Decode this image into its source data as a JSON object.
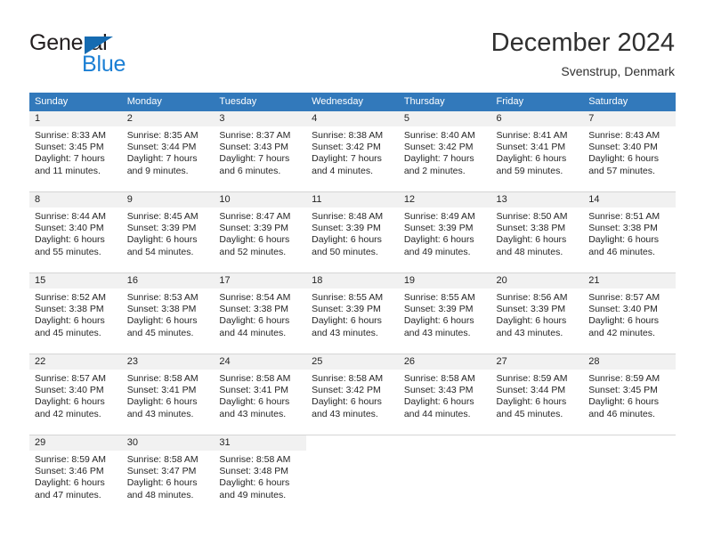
{
  "brand": {
    "name_part1": "General",
    "name_part2": "Blue",
    "triangle_color": "#156bb1",
    "blue_color": "#1b7fd4"
  },
  "header": {
    "month_title": "December 2024",
    "location": "Svenstrup, Denmark"
  },
  "calendar": {
    "header_color": "#3279bb",
    "weekdays": [
      "Sunday",
      "Monday",
      "Tuesday",
      "Wednesday",
      "Thursday",
      "Friday",
      "Saturday"
    ],
    "weeks": [
      [
        {
          "day": "1",
          "sunrise": "Sunrise: 8:33 AM",
          "sunset": "Sunset: 3:45 PM",
          "daylight_line1": "Daylight: 7 hours",
          "daylight_line2": "and 11 minutes."
        },
        {
          "day": "2",
          "sunrise": "Sunrise: 8:35 AM",
          "sunset": "Sunset: 3:44 PM",
          "daylight_line1": "Daylight: 7 hours",
          "daylight_line2": "and 9 minutes."
        },
        {
          "day": "3",
          "sunrise": "Sunrise: 8:37 AM",
          "sunset": "Sunset: 3:43 PM",
          "daylight_line1": "Daylight: 7 hours",
          "daylight_line2": "and 6 minutes."
        },
        {
          "day": "4",
          "sunrise": "Sunrise: 8:38 AM",
          "sunset": "Sunset: 3:42 PM",
          "daylight_line1": "Daylight: 7 hours",
          "daylight_line2": "and 4 minutes."
        },
        {
          "day": "5",
          "sunrise": "Sunrise: 8:40 AM",
          "sunset": "Sunset: 3:42 PM",
          "daylight_line1": "Daylight: 7 hours",
          "daylight_line2": "and 2 minutes."
        },
        {
          "day": "6",
          "sunrise": "Sunrise: 8:41 AM",
          "sunset": "Sunset: 3:41 PM",
          "daylight_line1": "Daylight: 6 hours",
          "daylight_line2": "and 59 minutes."
        },
        {
          "day": "7",
          "sunrise": "Sunrise: 8:43 AM",
          "sunset": "Sunset: 3:40 PM",
          "daylight_line1": "Daylight: 6 hours",
          "daylight_line2": "and 57 minutes."
        }
      ],
      [
        {
          "day": "8",
          "sunrise": "Sunrise: 8:44 AM",
          "sunset": "Sunset: 3:40 PM",
          "daylight_line1": "Daylight: 6 hours",
          "daylight_line2": "and 55 minutes."
        },
        {
          "day": "9",
          "sunrise": "Sunrise: 8:45 AM",
          "sunset": "Sunset: 3:39 PM",
          "daylight_line1": "Daylight: 6 hours",
          "daylight_line2": "and 54 minutes."
        },
        {
          "day": "10",
          "sunrise": "Sunrise: 8:47 AM",
          "sunset": "Sunset: 3:39 PM",
          "daylight_line1": "Daylight: 6 hours",
          "daylight_line2": "and 52 minutes."
        },
        {
          "day": "11",
          "sunrise": "Sunrise: 8:48 AM",
          "sunset": "Sunset: 3:39 PM",
          "daylight_line1": "Daylight: 6 hours",
          "daylight_line2": "and 50 minutes."
        },
        {
          "day": "12",
          "sunrise": "Sunrise: 8:49 AM",
          "sunset": "Sunset: 3:39 PM",
          "daylight_line1": "Daylight: 6 hours",
          "daylight_line2": "and 49 minutes."
        },
        {
          "day": "13",
          "sunrise": "Sunrise: 8:50 AM",
          "sunset": "Sunset: 3:38 PM",
          "daylight_line1": "Daylight: 6 hours",
          "daylight_line2": "and 48 minutes."
        },
        {
          "day": "14",
          "sunrise": "Sunrise: 8:51 AM",
          "sunset": "Sunset: 3:38 PM",
          "daylight_line1": "Daylight: 6 hours",
          "daylight_line2": "and 46 minutes."
        }
      ],
      [
        {
          "day": "15",
          "sunrise": "Sunrise: 8:52 AM",
          "sunset": "Sunset: 3:38 PM",
          "daylight_line1": "Daylight: 6 hours",
          "daylight_line2": "and 45 minutes."
        },
        {
          "day": "16",
          "sunrise": "Sunrise: 8:53 AM",
          "sunset": "Sunset: 3:38 PM",
          "daylight_line1": "Daylight: 6 hours",
          "daylight_line2": "and 45 minutes."
        },
        {
          "day": "17",
          "sunrise": "Sunrise: 8:54 AM",
          "sunset": "Sunset: 3:38 PM",
          "daylight_line1": "Daylight: 6 hours",
          "daylight_line2": "and 44 minutes."
        },
        {
          "day": "18",
          "sunrise": "Sunrise: 8:55 AM",
          "sunset": "Sunset: 3:39 PM",
          "daylight_line1": "Daylight: 6 hours",
          "daylight_line2": "and 43 minutes."
        },
        {
          "day": "19",
          "sunrise": "Sunrise: 8:55 AM",
          "sunset": "Sunset: 3:39 PM",
          "daylight_line1": "Daylight: 6 hours",
          "daylight_line2": "and 43 minutes."
        },
        {
          "day": "20",
          "sunrise": "Sunrise: 8:56 AM",
          "sunset": "Sunset: 3:39 PM",
          "daylight_line1": "Daylight: 6 hours",
          "daylight_line2": "and 43 minutes."
        },
        {
          "day": "21",
          "sunrise": "Sunrise: 8:57 AM",
          "sunset": "Sunset: 3:40 PM",
          "daylight_line1": "Daylight: 6 hours",
          "daylight_line2": "and 42 minutes."
        }
      ],
      [
        {
          "day": "22",
          "sunrise": "Sunrise: 8:57 AM",
          "sunset": "Sunset: 3:40 PM",
          "daylight_line1": "Daylight: 6 hours",
          "daylight_line2": "and 42 minutes."
        },
        {
          "day": "23",
          "sunrise": "Sunrise: 8:58 AM",
          "sunset": "Sunset: 3:41 PM",
          "daylight_line1": "Daylight: 6 hours",
          "daylight_line2": "and 43 minutes."
        },
        {
          "day": "24",
          "sunrise": "Sunrise: 8:58 AM",
          "sunset": "Sunset: 3:41 PM",
          "daylight_line1": "Daylight: 6 hours",
          "daylight_line2": "and 43 minutes."
        },
        {
          "day": "25",
          "sunrise": "Sunrise: 8:58 AM",
          "sunset": "Sunset: 3:42 PM",
          "daylight_line1": "Daylight: 6 hours",
          "daylight_line2": "and 43 minutes."
        },
        {
          "day": "26",
          "sunrise": "Sunrise: 8:58 AM",
          "sunset": "Sunset: 3:43 PM",
          "daylight_line1": "Daylight: 6 hours",
          "daylight_line2": "and 44 minutes."
        },
        {
          "day": "27",
          "sunrise": "Sunrise: 8:59 AM",
          "sunset": "Sunset: 3:44 PM",
          "daylight_line1": "Daylight: 6 hours",
          "daylight_line2": "and 45 minutes."
        },
        {
          "day": "28",
          "sunrise": "Sunrise: 8:59 AM",
          "sunset": "Sunset: 3:45 PM",
          "daylight_line1": "Daylight: 6 hours",
          "daylight_line2": "and 46 minutes."
        }
      ],
      [
        {
          "day": "29",
          "sunrise": "Sunrise: 8:59 AM",
          "sunset": "Sunset: 3:46 PM",
          "daylight_line1": "Daylight: 6 hours",
          "daylight_line2": "and 47 minutes."
        },
        {
          "day": "30",
          "sunrise": "Sunrise: 8:58 AM",
          "sunset": "Sunset: 3:47 PM",
          "daylight_line1": "Daylight: 6 hours",
          "daylight_line2": "and 48 minutes."
        },
        {
          "day": "31",
          "sunrise": "Sunrise: 8:58 AM",
          "sunset": "Sunset: 3:48 PM",
          "daylight_line1": "Daylight: 6 hours",
          "daylight_line2": "and 49 minutes."
        },
        {
          "day": "",
          "sunrise": "",
          "sunset": "",
          "daylight_line1": "",
          "daylight_line2": ""
        },
        {
          "day": "",
          "sunrise": "",
          "sunset": "",
          "daylight_line1": "",
          "daylight_line2": ""
        },
        {
          "day": "",
          "sunrise": "",
          "sunset": "",
          "daylight_line1": "",
          "daylight_line2": ""
        },
        {
          "day": "",
          "sunrise": "",
          "sunset": "",
          "daylight_line1": "",
          "daylight_line2": ""
        }
      ]
    ]
  }
}
